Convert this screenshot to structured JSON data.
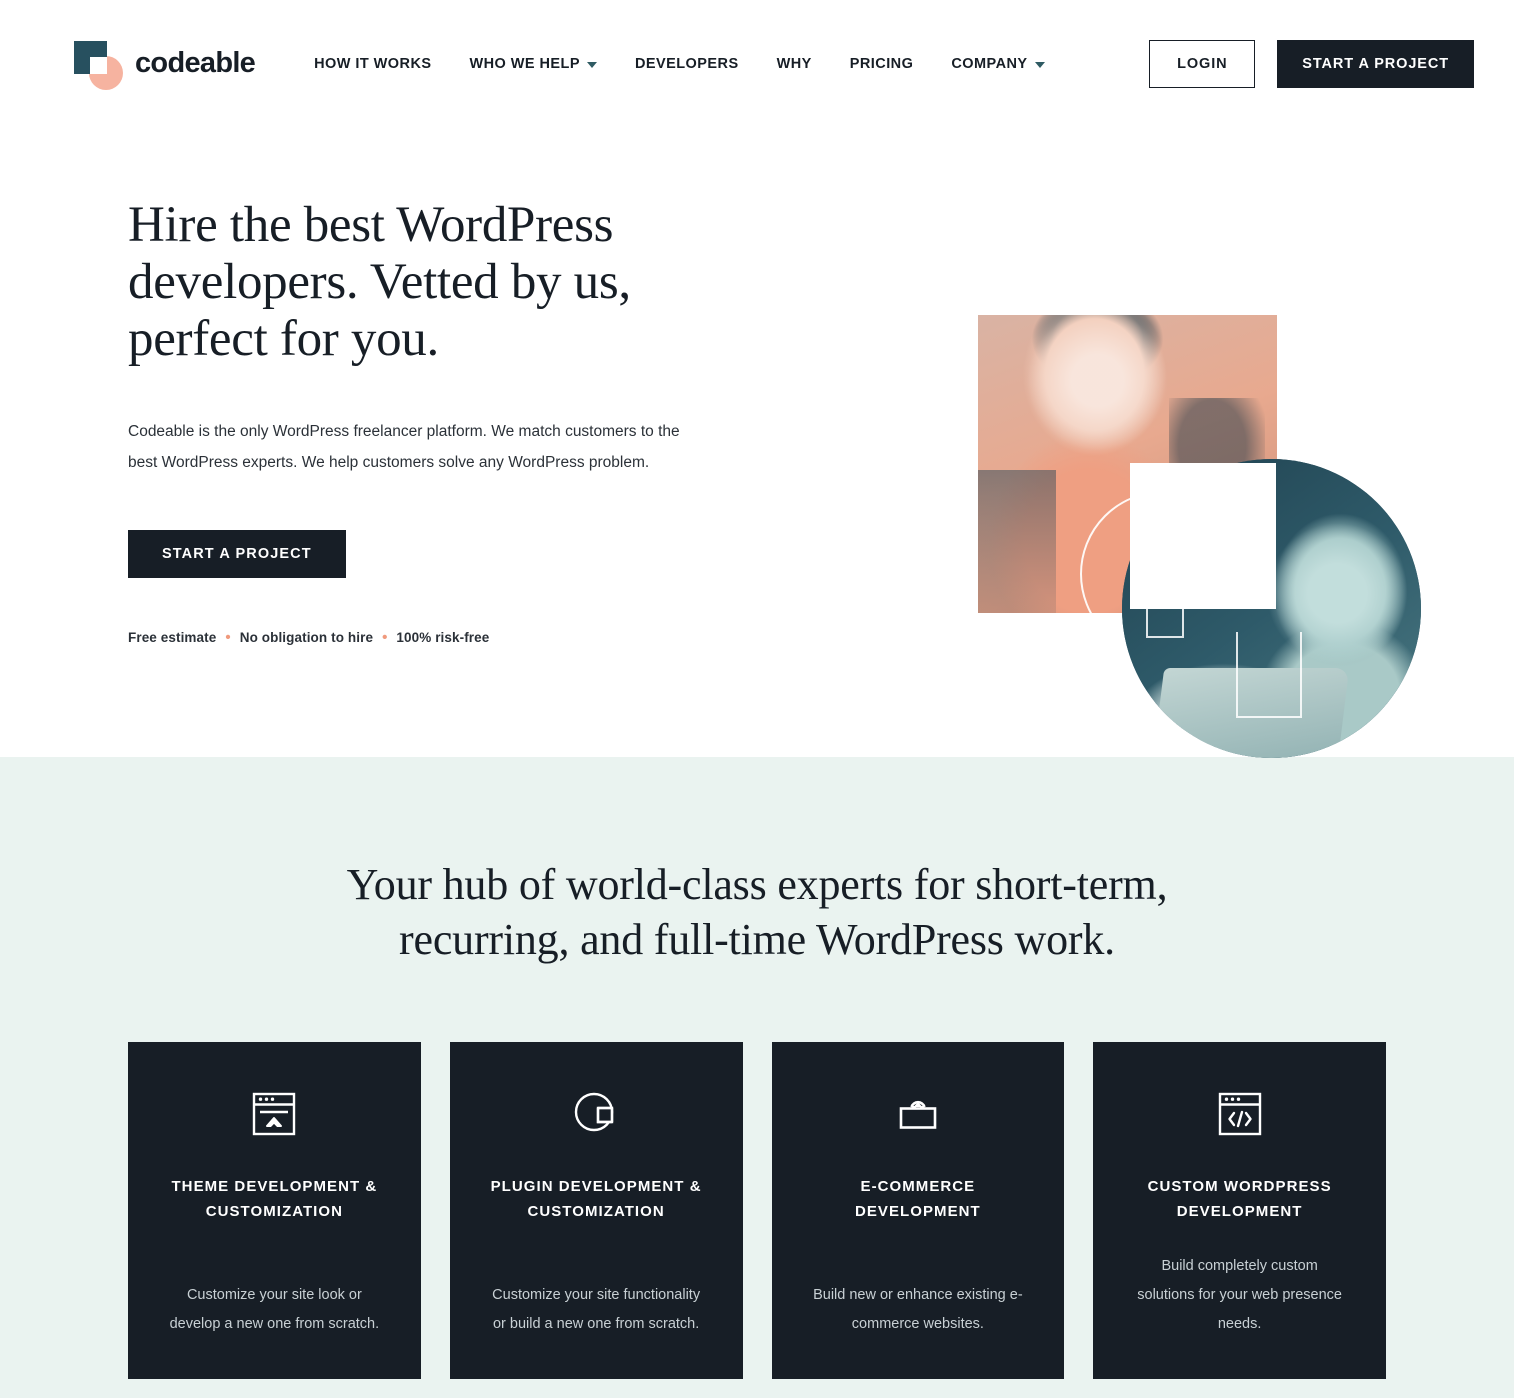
{
  "brand": {
    "name": "codeable",
    "mark_square_color": "#27505f",
    "mark_circle_color": "#f6b3a0"
  },
  "header": {
    "nav": [
      {
        "label": "HOW IT WORKS",
        "has_dropdown": false
      },
      {
        "label": "WHO WE HELP",
        "has_dropdown": true
      },
      {
        "label": "DEVELOPERS",
        "has_dropdown": false
      },
      {
        "label": "WHY",
        "has_dropdown": false
      },
      {
        "label": "PRICING",
        "has_dropdown": false
      },
      {
        "label": "COMPANY",
        "has_dropdown": true
      }
    ],
    "login_label": "LOGIN",
    "cta_label": "START A PROJECT"
  },
  "hero": {
    "title": "Hire the best WordPress developers. Vetted by us, perfect for you.",
    "paragraph": "Codeable is the only WordPress freelancer platform. We match customers to the best WordPress experts. We help customers solve any WordPress problem.",
    "cta_label": "START A PROJECT",
    "trust": [
      "Free estimate",
      "No obligation to hire",
      "100% risk-free"
    ],
    "trust_separator": "•",
    "separator_color": "#f09a7d"
  },
  "services": {
    "heading": "Your hub of world-class experts for short-term, recurring, and full-time WordPress work.",
    "background_color": "#eaf3f0",
    "card_background_color": "#171e26",
    "cards": [
      {
        "icon": "browser-theme-icon",
        "title": "THEME DEVELOPMENT & CUSTOMIZATION",
        "description": "Customize your site look or develop a new one from scratch."
      },
      {
        "icon": "pie-chart-plugin-icon",
        "title": "PLUGIN DEVELOPMENT & CUSTOMIZATION",
        "description": "Customize your site functionality or build a new one from scratch."
      },
      {
        "icon": "shopping-bag-icon",
        "title": "E-COMMERCE DEVELOPMENT",
        "description": "Build new or enhance existing e-commerce websites."
      },
      {
        "icon": "browser-code-icon",
        "title": "CUSTOM WORDPRESS DEVELOPMENT",
        "description": "Build completely custom solutions for your web presence needs."
      }
    ]
  }
}
